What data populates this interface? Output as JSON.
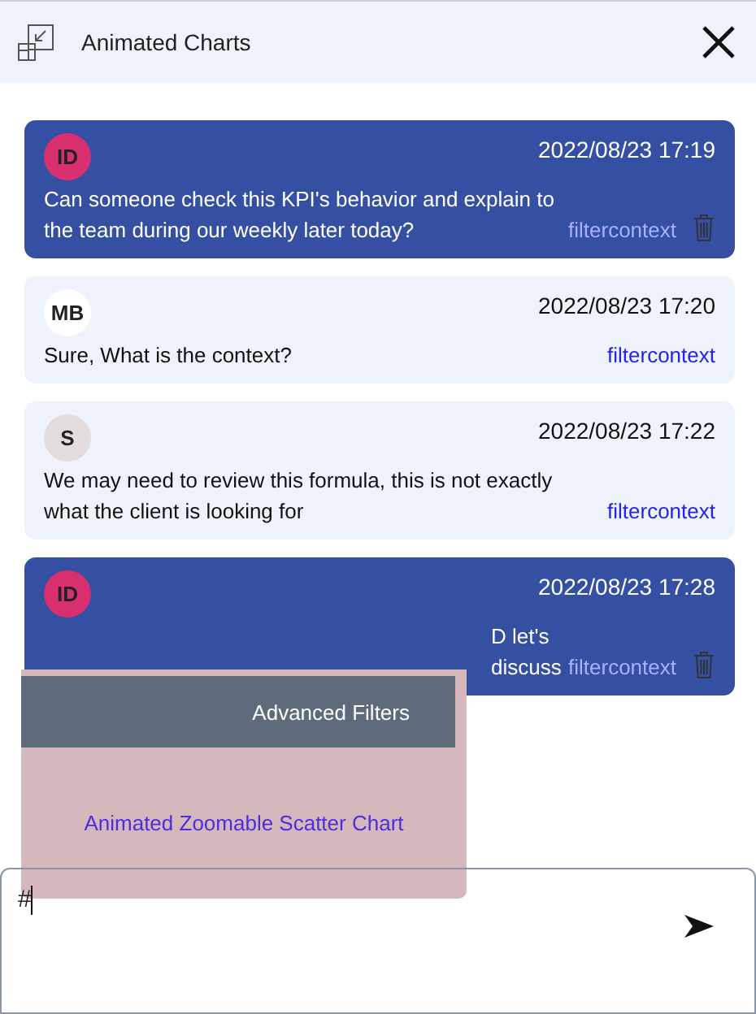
{
  "window": {
    "title": "Animated Charts"
  },
  "messages": [
    {
      "kind": "own",
      "initials": "ID",
      "color": "#d8306f",
      "time": "2022/08/23 17:19",
      "text": "Can someone check this KPI's behavior and explain to the team during our weekly later today?",
      "link": "filtercontext",
      "deletable": true,
      "covered": false
    },
    {
      "kind": "other",
      "initials": "MB",
      "color": "#ffffff",
      "time": "2022/08/23 17:20",
      "text": "Sure, What is the context?",
      "link": "filtercontext",
      "deletable": false,
      "covered": false
    },
    {
      "kind": "other",
      "initials": "S",
      "color": "#e3dcdc",
      "time": "2022/08/23 17:22",
      "text": " We may need to review this formula, this is not exactly what the client is looking for",
      "link": "filtercontext",
      "deletable": false,
      "covered": false
    },
    {
      "kind": "own",
      "initials": "ID",
      "color": "#d8306f",
      "time": "2022/08/23 17:28",
      "text": "D let's discuss",
      "link": "filtercontext",
      "deletable": true,
      "covered": true
    }
  ],
  "mention_menu": {
    "items": [
      {
        "label": "Advanced Filters",
        "selected": true
      },
      {
        "label": "Animated Zoomable Scatter Chart",
        "selected": false
      }
    ]
  },
  "composer": {
    "value": "#"
  }
}
